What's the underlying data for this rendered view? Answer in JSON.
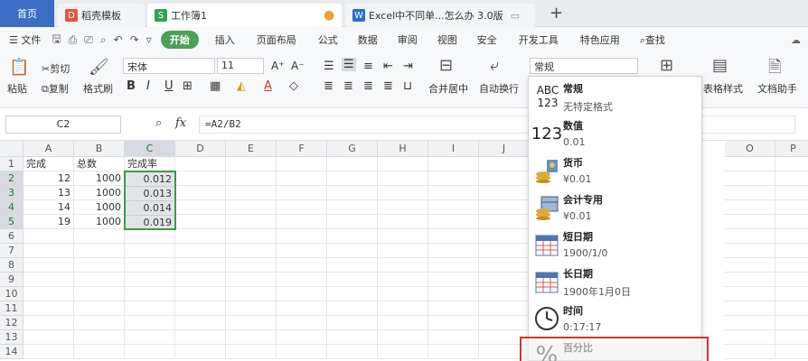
{
  "tabs": {
    "home": "首页",
    "daoke": "稻壳模板",
    "book": "工作簿1",
    "excel": "Excel中不同单...怎么办 3.0版",
    "add": "+"
  },
  "menu": {
    "file": "文件",
    "start": "开始",
    "items": [
      "插入",
      "页面布局",
      "公式",
      "数据",
      "审阅",
      "视图",
      "安全",
      "开发工具",
      "特色应用"
    ],
    "search": "查找"
  },
  "ribbon": {
    "paste": "粘贴",
    "cut": "剪切",
    "copy": "复制",
    "format_painter": "格式刷",
    "font_name": "宋体",
    "font_size": "11",
    "merge": "合并居中",
    "wrap": "自动换行",
    "number_format": "常规",
    "table_style": "表格样式",
    "doc_helper": "文档助手"
  },
  "formula_bar": {
    "cell_ref": "C2",
    "fx": "fx",
    "formula": "=A2/B2"
  },
  "columns": [
    "A",
    "B",
    "C",
    "D",
    "E",
    "F",
    "G",
    "H",
    "I",
    "J",
    "O",
    "P"
  ],
  "rows": [
    "1",
    "2",
    "3",
    "4",
    "5",
    "6",
    "7",
    "8",
    "9",
    "10",
    "11",
    "12",
    "13",
    "14"
  ],
  "table": {
    "headers": [
      "完成",
      "总数",
      "完成率"
    ],
    "data": [
      [
        "12",
        "1000",
        "0.012"
      ],
      [
        "13",
        "1000",
        "0.013"
      ],
      [
        "14",
        "1000",
        "0.014"
      ],
      [
        "19",
        "1000",
        "0.019"
      ]
    ]
  },
  "dropdown": [
    {
      "icon": "ABC 123",
      "title": "常规",
      "sample": "无特定格式"
    },
    {
      "icon": "123",
      "title": "数值",
      "sample": "0.01"
    },
    {
      "icon": "coins-icon",
      "title": "货币",
      "sample": "¥0.01"
    },
    {
      "icon": "ledger-icon",
      "title": "会计专用",
      "sample": "¥0.01"
    },
    {
      "icon": "calendar-icon",
      "title": "短日期",
      "sample": "1900/1/0"
    },
    {
      "icon": "calendar-icon",
      "title": "长日期",
      "sample": "1900年1月0日"
    },
    {
      "icon": "clock-icon",
      "title": "时间",
      "sample": "0:17:17"
    },
    {
      "icon": "%",
      "title": "百分比",
      "sample": ""
    }
  ]
}
